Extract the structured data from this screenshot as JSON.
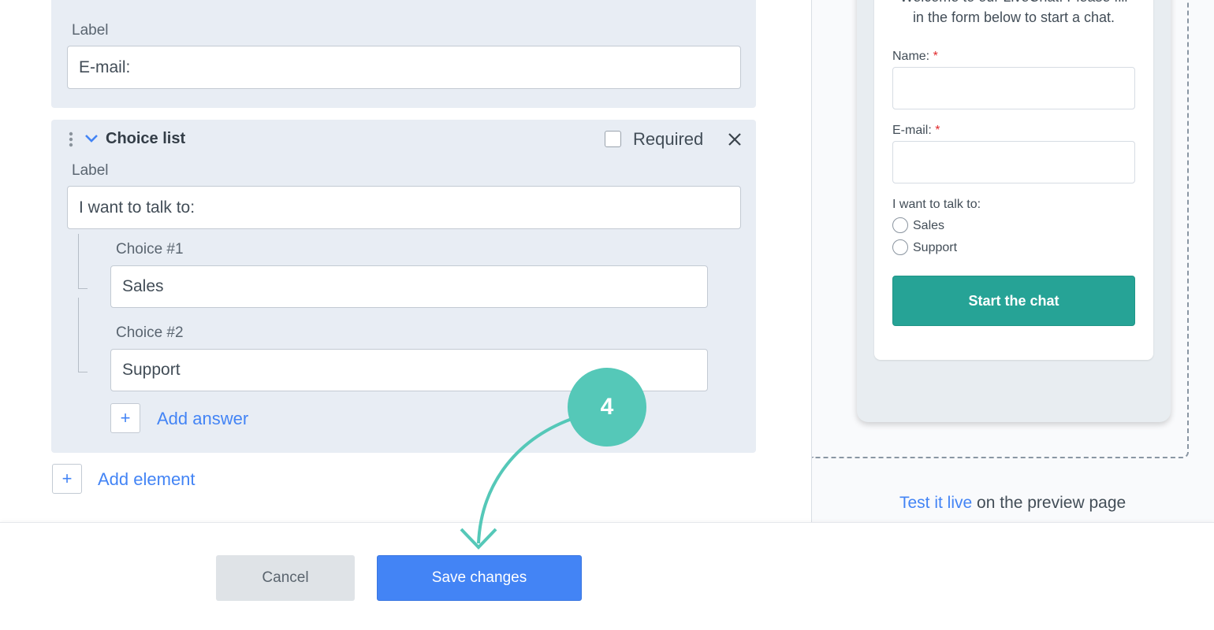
{
  "editor": {
    "email_field": {
      "label_caption": "Label",
      "label_value": "E-mail:"
    },
    "choice_list": {
      "title": "Choice list",
      "required_label": "Required",
      "required_checked": false,
      "label_caption": "Label",
      "label_value": "I want to talk to:",
      "choices": [
        {
          "caption": "Choice #1",
          "value": "Sales"
        },
        {
          "caption": "Choice #2",
          "value": "Support"
        }
      ],
      "add_answer": "Add answer"
    },
    "add_element": "Add element"
  },
  "preview": {
    "welcome_line1": "Welcome to our LiveChat! Please fill",
    "welcome_line2": "in the form below to start a chat.",
    "name_label": "Name:",
    "email_label": "E-mail:",
    "required_mark": "*",
    "question": "I want to talk to:",
    "options": [
      "Sales",
      "Support"
    ],
    "start_button": "Start the chat",
    "start_button_color": "#26a396",
    "test_link": "Test it live",
    "test_suffix": " on the preview page"
  },
  "footer": {
    "cancel": "Cancel",
    "save": "Save changes",
    "save_color": "#4384f5"
  },
  "callout": {
    "step": "4",
    "color": "#55c8b8"
  }
}
